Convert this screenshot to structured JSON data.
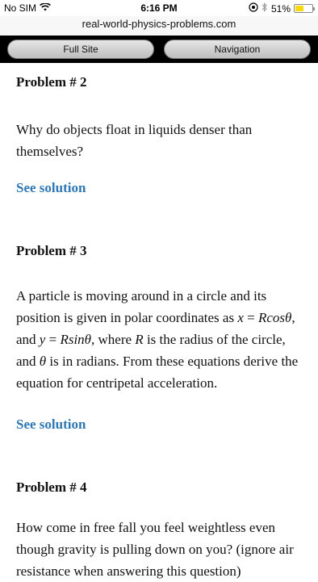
{
  "status": {
    "carrier": "No SIM",
    "time": "6:16 PM",
    "battery": "51%",
    "battery_level": 0.51
  },
  "browser": {
    "url": "real-world-physics-problems.com"
  },
  "nav": {
    "full_site": "Full Site",
    "navigation": "Navigation"
  },
  "problems": [
    {
      "title": "Problem # 2",
      "text": "Why do objects float in liquids denser than themselves?",
      "link": "See solution"
    },
    {
      "title": "Problem # 3",
      "text_parts": [
        "A particle is moving around in a circle and its position is given in polar coordinates as ",
        "x",
        " = ",
        "Rcosθ",
        ", and ",
        "y",
        " = ",
        "Rsinθ",
        ", where ",
        "R",
        " is the radius of the circle, and ",
        "θ",
        " is in radians. From these equations derive the equation for centripetal acceleration."
      ],
      "link": "See solution"
    },
    {
      "title": "Problem # 4",
      "text": "How come in free fall you feel weightless even though gravity is pulling down on you? (ignore air resistance when answering this question)"
    }
  ]
}
